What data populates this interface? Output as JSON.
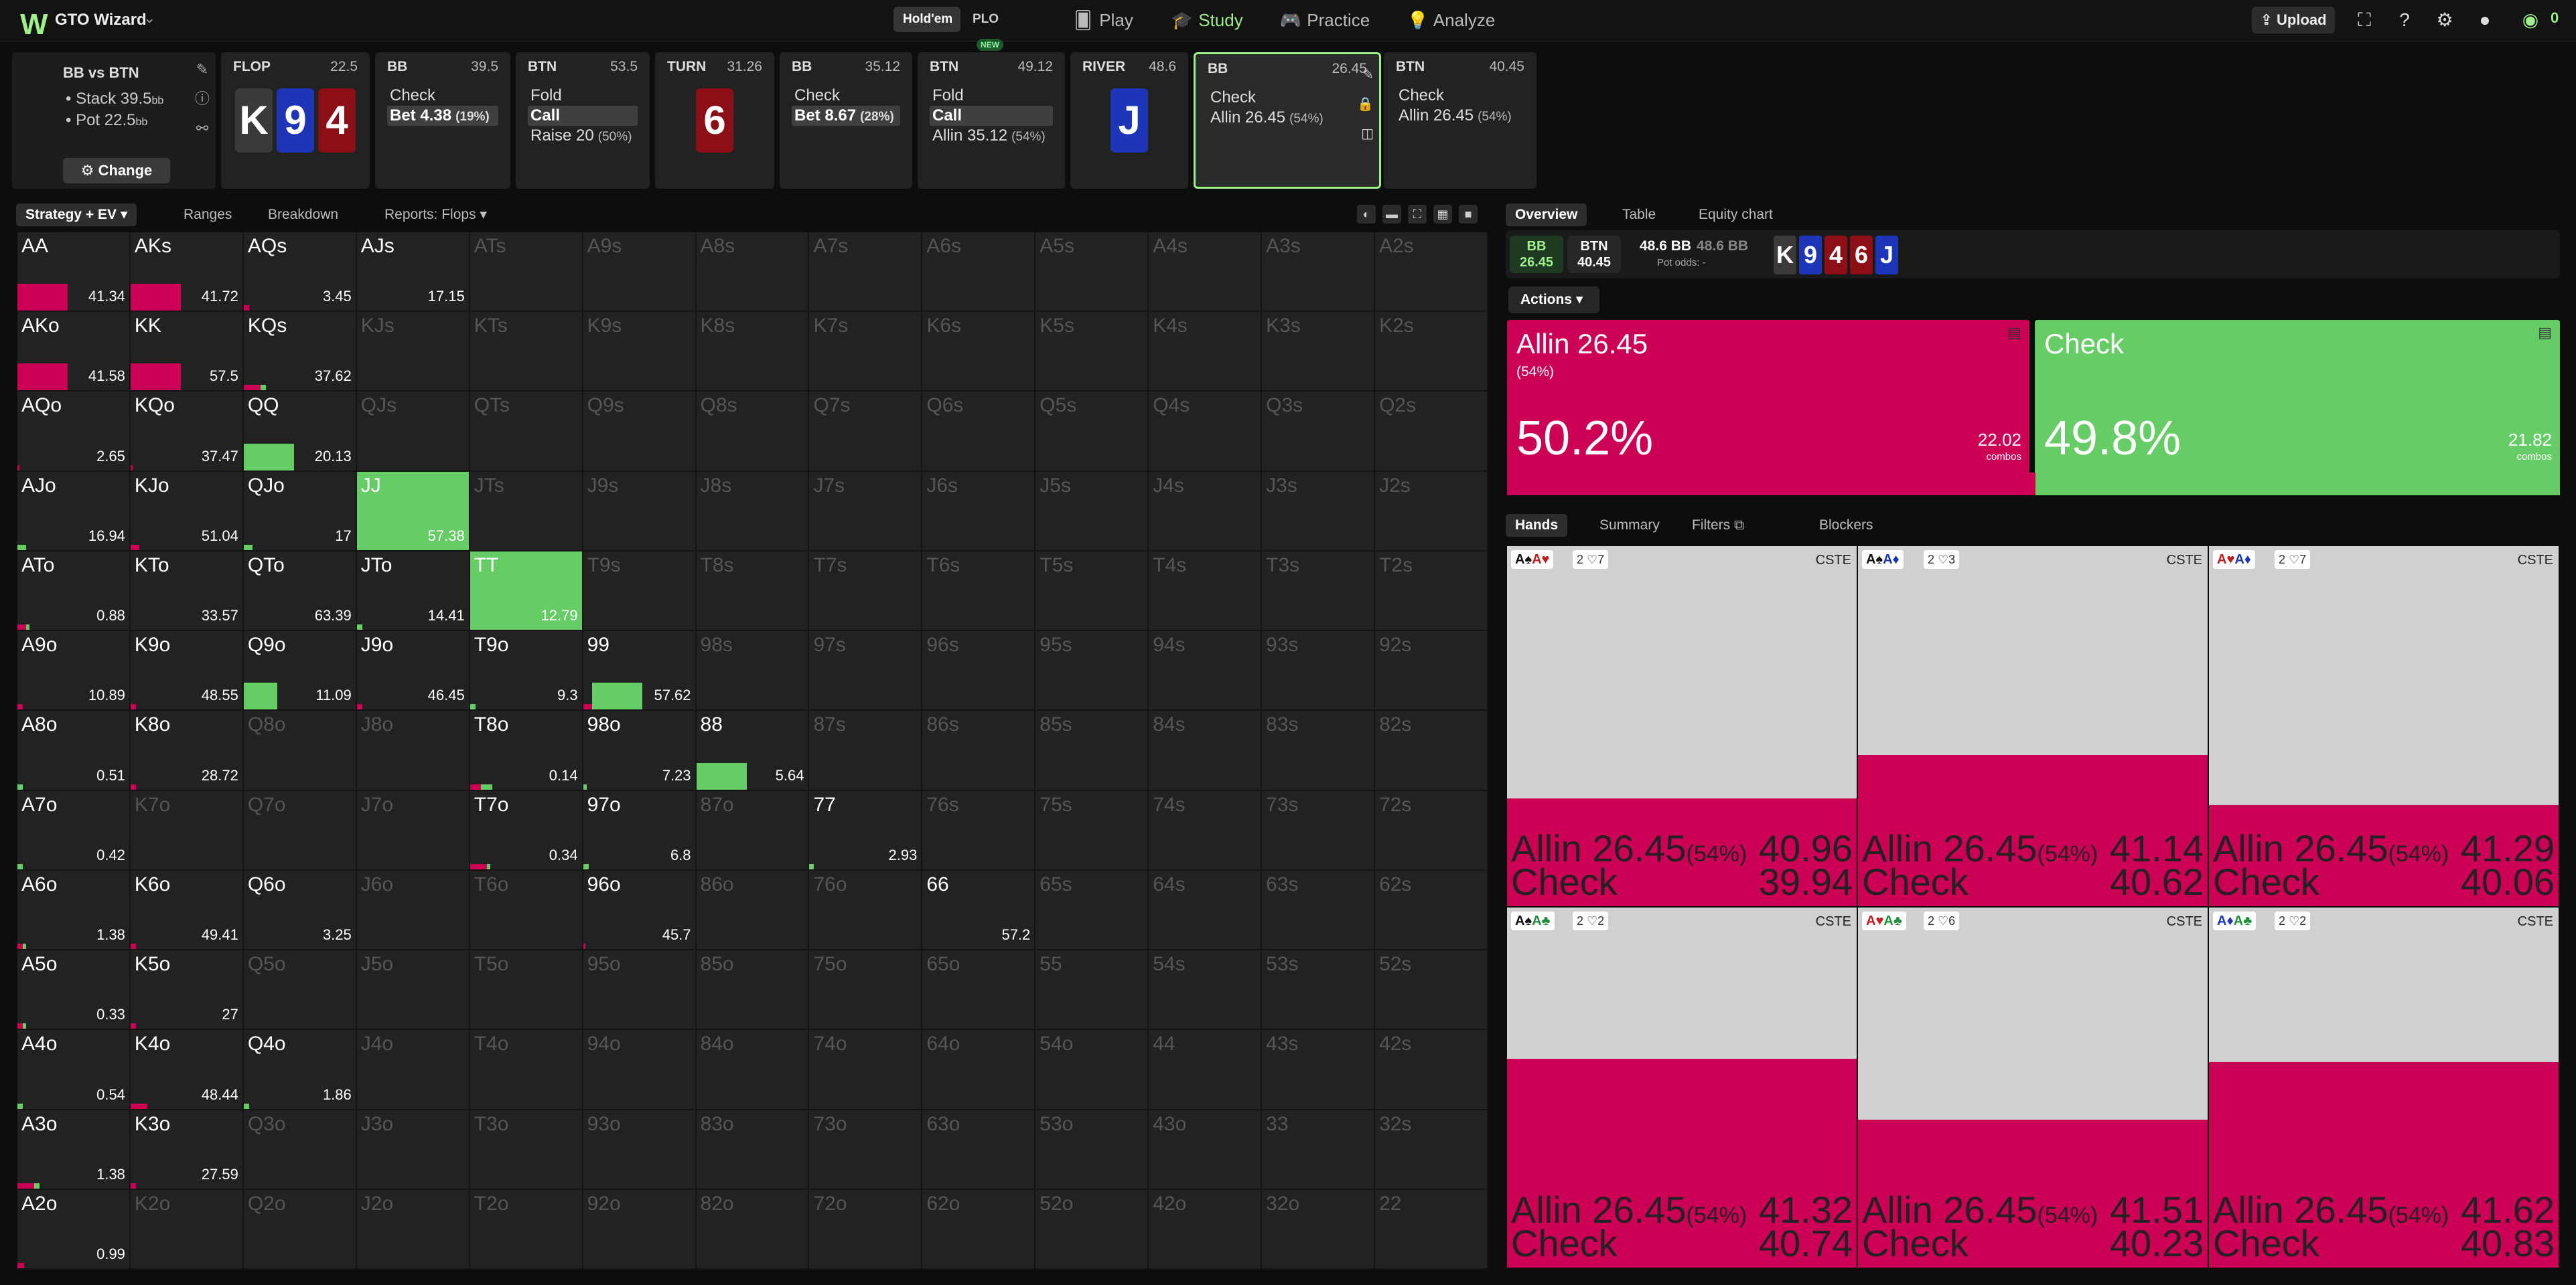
{
  "app": {
    "brand": "GTO Wizard",
    "logo": "W"
  },
  "topbar": {
    "game_holdem": "Hold'em",
    "game_plo": "PLO",
    "plo_badge": "NEW",
    "nav": [
      {
        "label": "Play",
        "icon": "cards-icon"
      },
      {
        "label": "Study",
        "icon": "graduation-cap-icon"
      },
      {
        "label": "Practice",
        "icon": "gamepad-icon"
      },
      {
        "label": "Analyze",
        "icon": "lightbulb-icon"
      }
    ],
    "upload": "Upload",
    "chip_count": "0"
  },
  "info": {
    "title": "BB vs BTN",
    "stack": "Stack 39.5",
    "stack_unit": "bb",
    "pot": "Pot 22.5",
    "pot_unit": "bb",
    "change": "Change"
  },
  "history": [
    {
      "title": "FLOP",
      "value": "22.5",
      "cards": [
        {
          "r": "K",
          "s": "c"
        },
        {
          "r": "9",
          "s": "d"
        },
        {
          "r": "4",
          "s": "h"
        }
      ]
    },
    {
      "title": "BB",
      "value": "39.5",
      "lines": [
        {
          "t": "Check",
          "p": "",
          "sel": false
        },
        {
          "t": "Bet 4.38",
          "p": "(19%)",
          "sel": true
        }
      ]
    },
    {
      "title": "BTN",
      "value": "53.5",
      "lines": [
        {
          "t": "Fold",
          "p": "",
          "sel": false
        },
        {
          "t": "Call",
          "p": "",
          "sel": true
        },
        {
          "t": "Raise 20",
          "p": "(50%)",
          "sel": false
        }
      ]
    },
    {
      "title": "TURN",
      "value": "31.26",
      "cards": [
        {
          "r": "6",
          "s": "h"
        }
      ]
    },
    {
      "title": "BB",
      "value": "35.12",
      "lines": [
        {
          "t": "Check",
          "p": "",
          "sel": false
        },
        {
          "t": "Bet 8.67",
          "p": "(28%)",
          "sel": true
        }
      ]
    },
    {
      "title": "BTN",
      "value": "49.12",
      "lines": [
        {
          "t": "Fold",
          "p": "",
          "sel": false
        },
        {
          "t": "Call",
          "p": "",
          "sel": true
        },
        {
          "t": "Allin 35.12",
          "p": "(54%)",
          "sel": false
        }
      ]
    },
    {
      "title": "RIVER",
      "value": "48.6",
      "cards": [
        {
          "r": "J",
          "s": "d"
        }
      ]
    },
    {
      "title": "BB",
      "value": "26.45",
      "lines": [
        {
          "t": "Check",
          "p": "",
          "sel": false
        },
        {
          "t": "Allin 26.45",
          "p": "(54%)",
          "sel": false
        }
      ]
    },
    {
      "title": "BTN",
      "value": "40.45",
      "lines": [
        {
          "t": "Check",
          "p": "",
          "sel": false
        },
        {
          "t": "Allin 26.45",
          "p": "(54%)",
          "sel": false
        }
      ]
    }
  ],
  "left_tabs": [
    "Strategy + EV",
    "Ranges",
    "Breakdown",
    "Reports: Flops"
  ],
  "matrix_ranks": [
    "A",
    "K",
    "Q",
    "J",
    "T",
    "9",
    "8",
    "7",
    "6",
    "5",
    "4",
    "3",
    "2"
  ],
  "matrix_cells": {
    "AA": {
      "ev": "41.34",
      "f": 0.45,
      "c": 0.0
    },
    "AKs": {
      "ev": "41.72",
      "f": 0.45,
      "c": 0.0
    },
    "AQs": {
      "ev": "3.45",
      "f": 0.05,
      "c": 0.0
    },
    "AJs": {
      "ev": "17.15",
      "f": 0.0,
      "c": 0.0
    },
    "AKo": {
      "ev": "41.58",
      "f": 0.45,
      "c": 0.0
    },
    "KK": {
      "ev": "57.5",
      "f": 0.45,
      "c": 0.0
    },
    "KQs": {
      "ev": "37.62",
      "f": 0.15,
      "c": 0.05
    },
    "AQo": {
      "ev": "2.65",
      "f": 0.02,
      "c": 0.0
    },
    "KQo": {
      "ev": "37.47",
      "f": 0.02,
      "c": 0.0
    },
    "QQ": {
      "ev": "20.13",
      "f": 0.0,
      "c": 0.45
    },
    "AJo": {
      "ev": "16.94",
      "f": 0.0,
      "c": 0.08
    },
    "KJo": {
      "ev": "51.04",
      "f": 0.08,
      "c": 0.0
    },
    "QJo": {
      "ev": "17",
      "f": 0.0,
      "c": 0.08
    },
    "JJ": {
      "ev": "57.38",
      "f": 0.0,
      "c": 1.0
    },
    "ATo": {
      "ev": "0.88",
      "f": 0.08,
      "c": 0.03
    },
    "KTo": {
      "ev": "33.57",
      "f": 0.0,
      "c": 0.0
    },
    "QTo": {
      "ev": "63.39",
      "f": 0.0,
      "c": 0.0
    },
    "JTo": {
      "ev": "14.41",
      "f": 0.0,
      "c": 0.05
    },
    "TT": {
      "ev": "12.79",
      "f": 0.0,
      "c": 1.0
    },
    "A9o": {
      "ev": "10.89",
      "f": 0.05,
      "c": 0.0
    },
    "K9o": {
      "ev": "48.55",
      "f": 0.05,
      "c": 0.0
    },
    "Q9o": {
      "ev": "11.09",
      "f": 0.0,
      "c": 0.3
    },
    "J9o": {
      "ev": "46.45",
      "f": 0.05,
      "c": 0.0
    },
    "T9o": {
      "ev": "9.3",
      "f": 0.0,
      "c": 0.05
    },
    "99": {
      "ev": "57.62",
      "f": 0.08,
      "c": 0.45
    },
    "A8o": {
      "ev": "0.51",
      "f": 0.0,
      "c": 0.05
    },
    "K8o": {
      "ev": "28.72",
      "f": 0.05,
      "c": 0.0
    },
    "T8o": {
      "ev": "0.14",
      "f": 0.1,
      "c": 0.1
    },
    "98o": {
      "ev": "7.23",
      "f": 0.0,
      "c": 0.03
    },
    "88": {
      "ev": "5.64",
      "f": 0.0,
      "c": 0.45
    },
    "A7o": {
      "ev": "0.42",
      "f": 0.0,
      "c": 0.05
    },
    "T7o": {
      "ev": "0.34",
      "f": 0.15,
      "c": 0.03
    },
    "97o": {
      "ev": "6.8",
      "f": 0.0,
      "c": 0.05
    },
    "77": {
      "ev": "2.93",
      "f": 0.0,
      "c": 0.04
    },
    "A6o": {
      "ev": "1.38",
      "f": 0.05,
      "c": 0.03
    },
    "K6o": {
      "ev": "49.41",
      "f": 0.05,
      "c": 0.0
    },
    "Q6o": {
      "ev": "3.25",
      "f": 0.0,
      "c": 0.0
    },
    "96o": {
      "ev": "45.7",
      "f": 0.02,
      "c": 0.0
    },
    "66": {
      "ev": "57.2",
      "f": 0.0,
      "c": 0.0
    },
    "A5o": {
      "ev": "0.33",
      "f": 0.05,
      "c": 0.03
    },
    "K5o": {
      "ev": "27",
      "f": 0.05,
      "c": 0.0
    },
    "A4o": {
      "ev": "0.54",
      "f": 0.0,
      "c": 0.05
    },
    "K4o": {
      "ev": "48.44",
      "f": 0.15,
      "c": 0.0
    },
    "Q4o": {
      "ev": "1.86",
      "f": 0.0,
      "c": 0.05
    },
    "A3o": {
      "ev": "1.38",
      "f": 0.15,
      "c": 0.05
    },
    "K3o": {
      "ev": "27.59",
      "f": 0.05,
      "c": 0.0
    },
    "A2o": {
      "ev": "0.99",
      "f": 0.06,
      "c": 0.0
    }
  },
  "right_tabs": [
    "Overview",
    "Table",
    "Equity chart"
  ],
  "spot": {
    "bb_label": "BB",
    "bb_val": "26.45",
    "btn_label": "BTN",
    "btn_val": "40.45",
    "pot": "48.6 BB",
    "pot_gray": "48.6 BB",
    "pot_odds": "Pot odds:  -",
    "board": [
      {
        "r": "K",
        "s": "c"
      },
      {
        "r": "9",
        "s": "d"
      },
      {
        "r": "4",
        "s": "h"
      },
      {
        "r": "6",
        "s": "h"
      },
      {
        "r": "J",
        "s": "d"
      }
    ]
  },
  "actions_label": "Actions",
  "actions": [
    {
      "name": "Allin 26.45",
      "pct": "(54%)",
      "freq": "50.2%",
      "freq_value": 0.502,
      "combos": "22.02",
      "combos_label": "combos",
      "color": "#cc0055"
    },
    {
      "name": "Check",
      "pct": "",
      "freq": "49.8%",
      "freq_value": 0.498,
      "combos": "21.82",
      "combos_label": "combos",
      "color": "#66cc66"
    }
  ],
  "hand_tabs": [
    "Hands",
    "Summary",
    "Filters",
    "Blockers"
  ],
  "hand_cards": [
    {
      "c1": "A",
      "s1": "s",
      "c2": "A",
      "s2": "h",
      "tag": "2 ♡7",
      "cste": "CSTE",
      "allin_pct": 0.3,
      "r1": "Allin 26.45",
      "r1p": "(54%)",
      "v1": "40.96",
      "r2": "Check",
      "v2": "39.94"
    },
    {
      "c1": "A",
      "s1": "s",
      "c2": "A",
      "s2": "d",
      "tag": "2 ♡3",
      "cste": "CSTE",
      "allin_pct": 0.42,
      "r1": "Allin 26.45",
      "r1p": "(54%)",
      "v1": "41.14",
      "r2": "Check",
      "v2": "40.62"
    },
    {
      "c1": "A",
      "s1": "h",
      "c2": "A",
      "s2": "d",
      "tag": "2 ♡7",
      "cste": "CSTE",
      "allin_pct": 0.28,
      "r1": "Allin 26.45",
      "r1p": "(54%)",
      "v1": "41.29",
      "r2": "Check",
      "v2": "40.06"
    },
    {
      "c1": "A",
      "s1": "s",
      "c2": "A",
      "s2": "c",
      "tag": "2 ♡2",
      "cste": "CSTE",
      "allin_pct": 0.58,
      "r1": "Allin 26.45",
      "r1p": "(54%)",
      "v1": "41.32",
      "r2": "Check",
      "v2": "40.74"
    },
    {
      "c1": "A",
      "s1": "h",
      "c2": "A",
      "s2": "c",
      "tag": "2 ♡6",
      "cste": "CSTE",
      "allin_pct": 0.41,
      "r1": "Allin 26.45",
      "r1p": "(54%)",
      "v1": "41.51",
      "r2": "Check",
      "v2": "40.23"
    },
    {
      "c1": "A",
      "s1": "d",
      "c2": "A",
      "s2": "c",
      "tag": "2 ♡2",
      "cste": "CSTE",
      "allin_pct": 0.57,
      "r1": "Allin 26.45",
      "r1p": "(54%)",
      "v1": "41.62",
      "r2": "Check",
      "v2": "40.83"
    }
  ]
}
